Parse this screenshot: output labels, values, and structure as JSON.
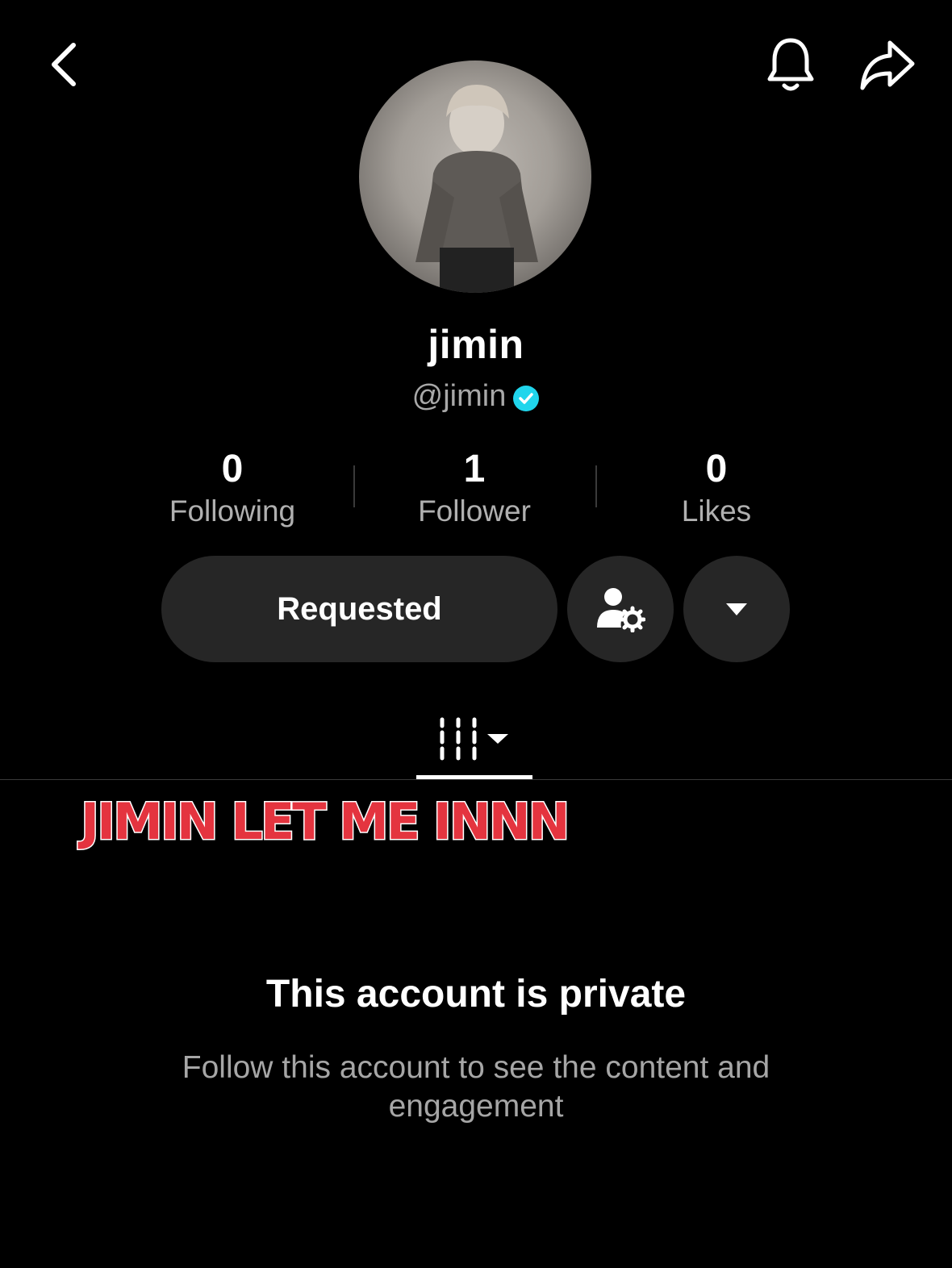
{
  "header": {
    "back_icon": "chevron-left-icon",
    "bell_icon": "bell-icon",
    "share_icon": "share-icon"
  },
  "profile": {
    "display_name": "jimin",
    "handle": "@jimin",
    "verified_color": "#20d5ec"
  },
  "stats": [
    {
      "value": "0",
      "label": "Following"
    },
    {
      "value": "1",
      "label": "Follower"
    },
    {
      "value": "0",
      "label": "Likes"
    }
  ],
  "actions": {
    "requested_label": "Requested",
    "suggested_accounts_icon": "person-gear-icon",
    "more_icon": "caret-down-icon"
  },
  "tabs": {
    "videos_icon": "grid-bars-icon"
  },
  "overlay": {
    "caption": "JIMIN LET ME INNN",
    "color": "#e4343f"
  },
  "private_notice": {
    "title": "This account is private",
    "description": "Follow this account to see the content and engagement"
  }
}
